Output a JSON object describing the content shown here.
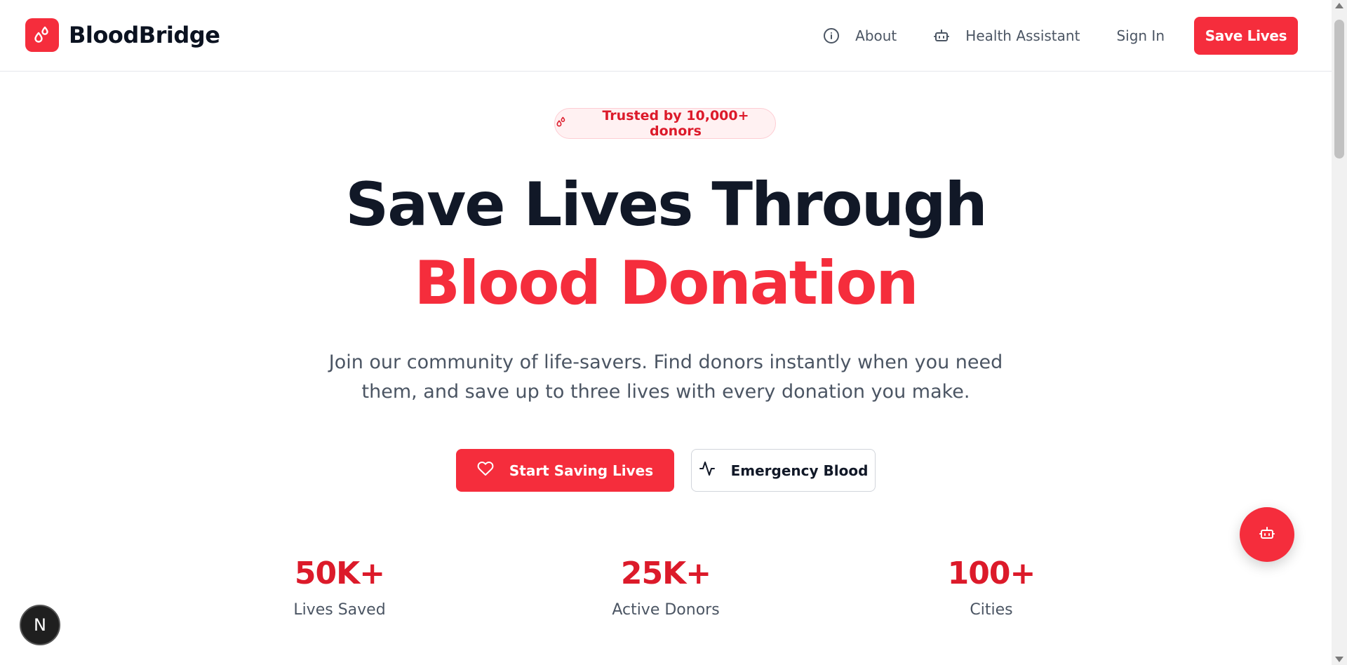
{
  "brand": {
    "name": "BloodBridge",
    "logo_icon": "blood-drops-icon"
  },
  "nav": {
    "items": [
      {
        "label": "About",
        "icon": "info-icon"
      },
      {
        "label": "Health Assistant",
        "icon": "robot-icon"
      }
    ],
    "sign_in": "Sign In",
    "cta": "Save Lives"
  },
  "hero": {
    "badge": "Trusted by 10,000+ donors",
    "title_line1": "Save Lives Through",
    "title_line2": "Blood Donation",
    "subtitle_line1": "Join our community of life-savers. Find donors instantly when you need",
    "subtitle_line2": "them, and save up to three lives with every donation you make.",
    "primary_button": "Start Saving Lives",
    "secondary_button": "Emergency Blood"
  },
  "stats": [
    {
      "value": "50K+",
      "label": "Lives Saved"
    },
    {
      "value": "25K+",
      "label": "Active Donors"
    },
    {
      "value": "100+",
      "label": "Cities"
    }
  ],
  "floating": {
    "assistant_icon": "robot-icon",
    "dev_badge": "N"
  },
  "colors": {
    "accent": "#f52d3c",
    "accent_dark": "#dc1a2a",
    "text": "#111827",
    "muted": "#4b5563"
  }
}
